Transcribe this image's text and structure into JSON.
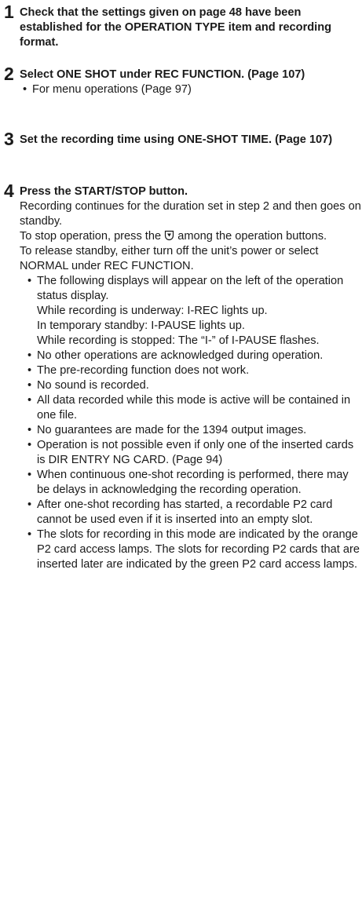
{
  "steps": [
    {
      "number": "1",
      "heading": "Check that the settings given on page 48 have been established for the OPERATION TYPE item and recording format."
    },
    {
      "number": "2",
      "heading": "Select ONE SHOT under REC FUNCTION. (Page 107)",
      "bullets": [
        "For menu operations (Page 97)"
      ]
    },
    {
      "number": "3",
      "heading": "Set the recording time using ONE-SHOT TIME. (Page 107)"
    },
    {
      "number": "4",
      "heading": "Press the START/STOP button.",
      "para1": "Recording continues for the duration set in step 2 and then goes on standby.",
      "para2_before": "To stop operation, press the",
      "stop_icon": "stop-button-icon",
      "para2_after": "among the operation buttons.",
      "para3": "To release standby, either turn off the unit’s power or select NORMAL under REC FUNCTION.",
      "bullet_dot": "•",
      "displays_bullet": {
        "intro": "The following displays will appear on the left of the operation status display.",
        "lines": [
          "While recording is underway: I-REC lights up.",
          "In temporary standby: I-PAUSE lights up.",
          "While recording is stopped: The “I-” of I-PAUSE flashes."
        ]
      },
      "bullets": [
        "No other operations are acknowledged during operation.",
        "The pre-recording function does not work.",
        "No sound is recorded.",
        "All data recorded while this mode is active will be contained in one file.",
        "No guarantees are made for the 1394 output images.",
        "Operation is not possible even if only one of the inserted cards is DIR ENTRY NG CARD. (Page 94)",
        "When continuous one-shot recording is performed, there may be delays in acknowledging the recording operation.",
        "After one-shot recording has started, a recordable P2 card cannot be used even if it is inserted into an empty slot.",
        "The slots for recording in this mode are indicated by the orange P2 card access lamps. The slots for recording P2 cards that are inserted later are indicated by the green P2 card access lamps."
      ]
    }
  ]
}
